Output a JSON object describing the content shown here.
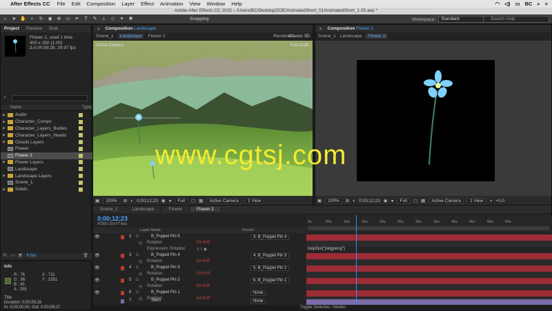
{
  "menubar": {
    "app": "After Effects CC",
    "items": [
      "File",
      "Edit",
      "Composition",
      "Layer",
      "Effect",
      "Animation",
      "View",
      "Window",
      "Help"
    ],
    "user": "BC"
  },
  "titlebar": {
    "title": "Adobe After Effects CC 2015 – /Users/BC/Desktop/ZOE/AnimatedShort_01/AnimatedShort_1.05.aep *"
  },
  "toolbar": {
    "snapping": "Snapping",
    "workspace_label": "Workspace:",
    "workspace_value": "Standard",
    "search_placeholder": "Search Help"
  },
  "project": {
    "tabs": [
      "Project",
      "Preview",
      "Duik"
    ],
    "selected_name": "Flower 2",
    "selected_used": ", used 1 time",
    "selected_size": "400 x 350 (1.00)",
    "selected_duration": "Δ 0;00;59;28, 29.97 fps",
    "column_name": "Name",
    "column_type": "Type",
    "items": [
      {
        "name": "Audio",
        "kind": "folder"
      },
      {
        "name": "Character_Comps",
        "kind": "folder"
      },
      {
        "name": "Character_Layers_Bodies",
        "kind": "folder"
      },
      {
        "name": "Character_Layers_Heads",
        "kind": "folder"
      },
      {
        "name": "Clouds Layers",
        "kind": "folder"
      },
      {
        "name": "Flower",
        "kind": "comp"
      },
      {
        "name": "Flower 2",
        "kind": "comp",
        "selected": true
      },
      {
        "name": "Flower Layers",
        "kind": "folder"
      },
      {
        "name": "Landscape",
        "kind": "comp"
      },
      {
        "name": "Landscape Layers",
        "kind": "folder"
      },
      {
        "name": "Scene_1",
        "kind": "comp"
      },
      {
        "name": "Solids",
        "kind": "folder"
      }
    ],
    "bpc": "8 bpc"
  },
  "info": {
    "title": "Info",
    "r": "R : 76",
    "g": "G : 96",
    "b": "B : 43",
    "a": "A : 255",
    "x": "X : 711",
    "y": "Y : 2351",
    "layer": "Title",
    "duration": "Duration: 0;00;59;28",
    "inout": "In: 0;00;00;00, Out: 0;00;59;27",
    "swatch": "#4f6b2b"
  },
  "comp1": {
    "panel_title": "Composition",
    "panel_comp": "Landscape",
    "crumbs": [
      "Scene_1",
      "Landscape",
      "Flower 2"
    ],
    "renderer_label": "Renderer:",
    "renderer": "Classic 3D",
    "view_label": "Active Camera",
    "draft": "Fast Draft",
    "zoom": "100%",
    "timecode": "0;00;12;23",
    "resolution": "Full",
    "camera": "Active Camera",
    "views": "1 View",
    "offset": "+0.0"
  },
  "comp2": {
    "panel_title": "Composition",
    "panel_comp": "Flower 2",
    "crumbs": [
      "Scene_1",
      "Landscape",
      "Flower 2"
    ],
    "zoom": "100%",
    "timecode": "0;00;12;23",
    "resolution": "Full",
    "camera": "Active Camera",
    "views": "1 View",
    "offset": "+0.0"
  },
  "timeline": {
    "tabs": [
      "Scene_1",
      "Landscape",
      "Flower",
      "Flower 2"
    ],
    "timecode": "0;00;12;23",
    "subcode": "00383 (29.97 fps)",
    "col_layer": "Layer Name",
    "col_parent": "Parent",
    "ticks": [
      "0s",
      "05s",
      "10s",
      "15s",
      "20s",
      "25s",
      "30s",
      "35s",
      "40s",
      "45s",
      "50s",
      "55s"
    ],
    "rows": [
      {
        "num": "2",
        "name": "B_Puppet Pin 5",
        "parent": "3. B_Puppet Pin 4",
        "type": "layer"
      },
      {
        "name": "Rotation",
        "value": "0x+3.6°",
        "type": "prop"
      },
      {
        "name": "Expression: Rotation",
        "type": "expr",
        "expr": "loopOut(\"pingpong\")"
      },
      {
        "num": "3",
        "name": "B_Puppet Pin 4",
        "parent": "4. B_Puppet Pin 3",
        "type": "layer"
      },
      {
        "name": "Rotation",
        "value": "0x+3.6°",
        "type": "prop"
      },
      {
        "num": "4",
        "name": "B_Puppet Pin 3",
        "parent": "5. B_Puppet Pin 2",
        "type": "layer"
      },
      {
        "name": "Rotation",
        "value": "0x+3.6°",
        "type": "prop"
      },
      {
        "num": "5",
        "name": "B_Puppet Pin 2",
        "parent": "6. B_Puppet Pin 1",
        "type": "layer"
      },
      {
        "name": "Rotation",
        "value": "0x+3.6°",
        "type": "prop"
      },
      {
        "num": "6",
        "name": "B_Puppet Pin 1",
        "parent": "None",
        "type": "layer"
      },
      {
        "name": "Rotation",
        "value": "0x+3.6°",
        "type": "prop"
      },
      {
        "num": "7",
        "name": "Stem",
        "parent": "None",
        "type": "stem"
      }
    ],
    "footer": "Toggle Switches / Modes"
  },
  "watermark": "www.cgtsj.com",
  "colors": {
    "accent": "#4fa3ff",
    "bar_red": "#9c2c35",
    "bar_purple": "#7a6da8",
    "label_red": "#c0392b"
  }
}
